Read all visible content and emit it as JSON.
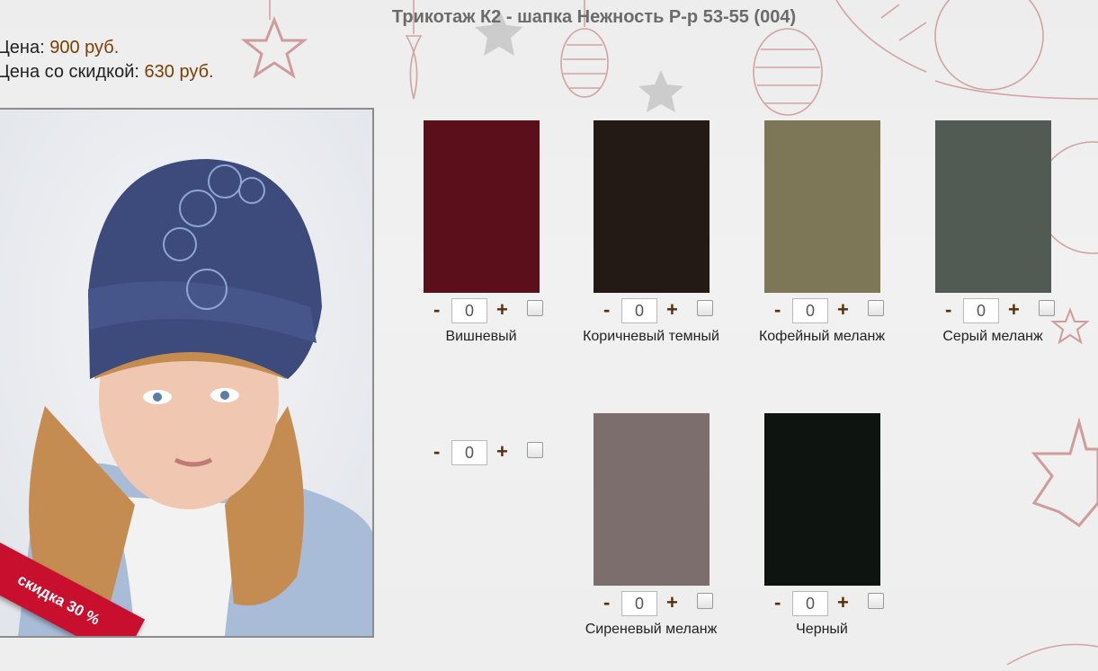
{
  "product": {
    "title": "Трикотаж К2 - шапка Нежность Р-р 53-55 (004)",
    "price_label": "Цена: ",
    "price_value": "900 руб.",
    "discount_label": "Цена со скидкой: ",
    "discount_value": "630 руб.",
    "badge": "скидка 30 %"
  },
  "colors": [
    {
      "name": "Вишневый",
      "qty": "0",
      "swatch": "#5a0f1a"
    },
    {
      "name": "Коричневый темный",
      "qty": "0",
      "swatch": "#241a15"
    },
    {
      "name": "Кофейный меланж",
      "qty": "0",
      "swatch": "#7d7757"
    },
    {
      "name": "Серый меланж",
      "qty": "0",
      "swatch": "#525a54"
    },
    {
      "name": "",
      "qty": "0",
      "swatch": ""
    },
    {
      "name": "Сиреневый меланж",
      "qty": "0",
      "swatch": "#7b6e6c"
    },
    {
      "name": "Черный",
      "qty": "0",
      "swatch": "#0e140f"
    }
  ],
  "stepper": {
    "minus": "-",
    "plus": "+"
  },
  "theme": {
    "accent": "#7a3e00",
    "decor": "#c98c8c"
  }
}
